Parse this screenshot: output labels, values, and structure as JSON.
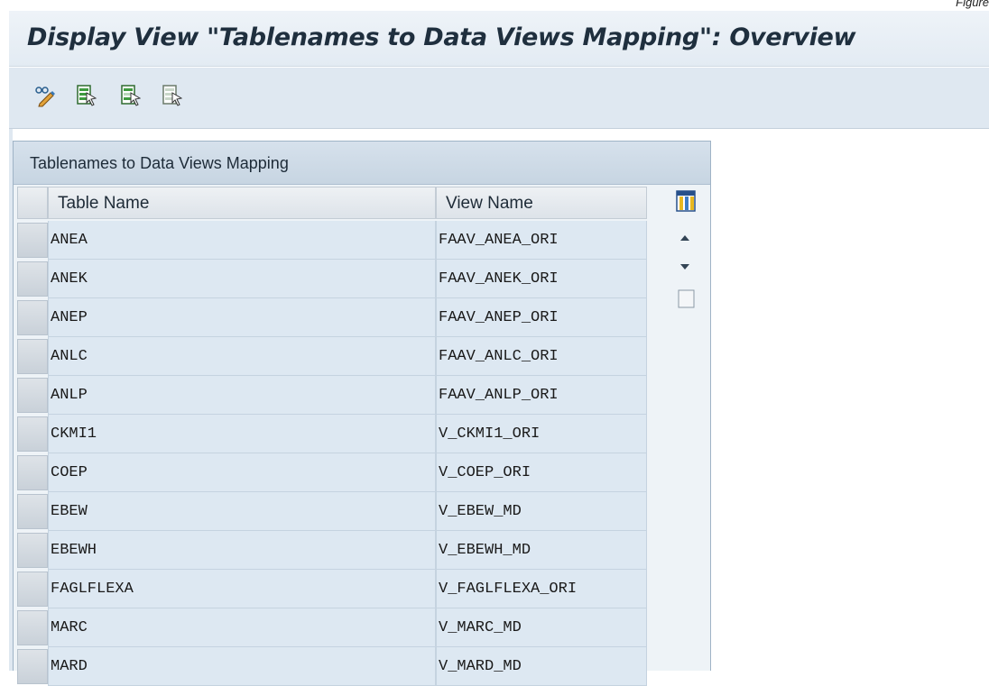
{
  "figure_label": "Figure",
  "header": {
    "title": "Display View \"Tablenames to Data Views Mapping\": Overview"
  },
  "toolbar": {
    "icons": [
      "change-display-icon",
      "select-all-icon",
      "select-block-icon",
      "deselect-all-icon"
    ]
  },
  "table": {
    "title": "Tablenames to Data Views Mapping",
    "columns": [
      "Table Name",
      "View Name"
    ],
    "rows": [
      {
        "table": "ANEA",
        "view": "FAAV_ANEA_ORI"
      },
      {
        "table": "ANEK",
        "view": "FAAV_ANEK_ORI"
      },
      {
        "table": "ANEP",
        "view": "FAAV_ANEP_ORI"
      },
      {
        "table": "ANLC",
        "view": "FAAV_ANLC_ORI"
      },
      {
        "table": "ANLP",
        "view": "FAAV_ANLP_ORI"
      },
      {
        "table": "CKMI1",
        "view": "V_CKMI1_ORI"
      },
      {
        "table": "COEP",
        "view": "V_COEP_ORI"
      },
      {
        "table": "EBEW",
        "view": "V_EBEW_MD"
      },
      {
        "table": "EBEWH",
        "view": "V_EBEWH_MD"
      },
      {
        "table": "FAGLFLEXA",
        "view": "V_FAGLFLEXA_ORI"
      },
      {
        "table": "MARC",
        "view": "V_MARC_MD"
      },
      {
        "table": "MARD",
        "view": "V_MARD_MD"
      }
    ]
  },
  "colors": {
    "title_bg": "#e8eff6",
    "toolbar_bg": "#dfe8f1",
    "cell_bg": "#dde8f2",
    "header_bg": "#cbd8e4"
  }
}
